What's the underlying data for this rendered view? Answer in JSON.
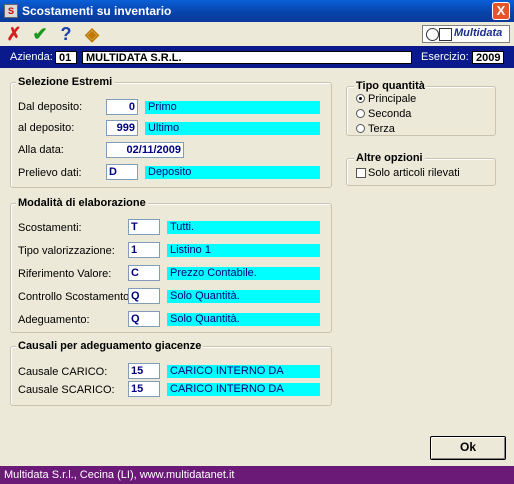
{
  "window": {
    "title": "Scostamenti su inventario",
    "close_glyph": "X",
    "app_icon_glyph": "S"
  },
  "toolbar": {
    "cancel_icon": "✗",
    "confirm_icon": "✔",
    "help_icon": "?",
    "tool_icon": "◈",
    "logo_text": "Multidata"
  },
  "company": {
    "azienda_label": "Azienda:",
    "azienda_code": "01",
    "azienda_name": "MULTIDATA S.R.L.",
    "esercizio_label": "Esercizio:",
    "esercizio_value": "2009"
  },
  "selezione": {
    "title": "Selezione Estremi",
    "dal_deposito_label": "Dal deposito:",
    "dal_deposito_value": "0",
    "dal_deposito_desc": "Primo",
    "al_deposito_label": "al deposito:",
    "al_deposito_value": "999",
    "al_deposito_desc": "Ultimo",
    "alla_data_label": "Alla data:",
    "alla_data_value": "02/11/2009",
    "prelievo_label": "Prelievo dati:",
    "prelievo_value": "D",
    "prelievo_desc": "Deposito"
  },
  "tipo_quantita": {
    "title": "Tipo quantità",
    "options": [
      "Principale",
      "Seconda",
      "Terza"
    ],
    "selected": "Principale"
  },
  "altre_opzioni": {
    "title": "Altre opzioni",
    "solo_articoli_label": "Solo articoli rilevati",
    "solo_articoli_checked": false
  },
  "modalita": {
    "title": "Modalità di elaborazione",
    "rows": [
      {
        "label": "Scostamenti:",
        "value": "T",
        "desc": "Tutti."
      },
      {
        "label": "Tipo valorizzazione:",
        "value": "1",
        "desc": "Listino 1"
      },
      {
        "label": "Riferimento Valore:",
        "value": "C",
        "desc": "Prezzo Contabile."
      },
      {
        "label": "Controllo Scostamento:",
        "value": "Q",
        "desc": "Solo Quantità."
      },
      {
        "label": "Adeguamento:",
        "value": "Q",
        "desc": "Solo Quantità."
      }
    ]
  },
  "causali": {
    "title": "Causali per adeguamento giacenze",
    "carico_label": "Causale CARICO:",
    "carico_value": "15",
    "carico_desc": "CARICO INTERNO DA",
    "scarico_label": "Causale SCARICO:",
    "scarico_value": "15",
    "scarico_desc": "CARICO INTERNO DA"
  },
  "buttons": {
    "ok_label": "Ok"
  },
  "status": {
    "text": "Multidata S.r.l., Cecina (LI), www.multidatanet.it"
  },
  "colors": {
    "titlebar": "#0842a8",
    "company_bar": "#0a1a8c",
    "status_bar": "#6b1a78",
    "desc_field": "#00ffff"
  }
}
